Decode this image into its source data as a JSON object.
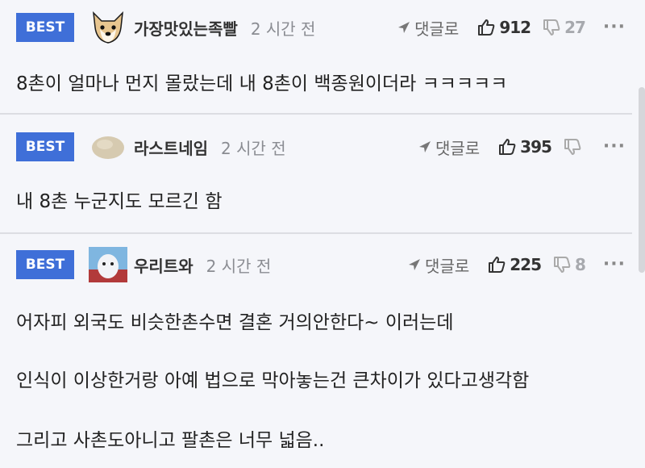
{
  "comments": [
    {
      "badge": "BEST",
      "nickname": "가장맛있는족빨",
      "time": "2 시간 전",
      "reply_label": "댓글로",
      "likes": "912",
      "dislikes": "27",
      "lines": [
        "8촌이 얼마나 먼지 몰랐는데 내 8촌이 백종원이더라 ㅋㅋㅋㅋㅋ"
      ]
    },
    {
      "badge": "BEST",
      "nickname": "라스트네임",
      "time": "2 시간 전",
      "reply_label": "댓글로",
      "likes": "395",
      "dislikes": "",
      "lines": [
        "내 8촌 누군지도 모르긴 함"
      ]
    },
    {
      "badge": "BEST",
      "nickname": "우리트와",
      "time": "2 시간 전",
      "reply_label": "댓글로",
      "likes": "225",
      "dislikes": "8",
      "lines": [
        "어자피 외국도 비슷한촌수면 결혼 거의안한다~ 이러는데",
        "인식이 이상한거랑 아예 법으로 막아놓는건 큰차이가 있다고생각함",
        "그리고 사촌도아니고 팔촌은 너무 넓음.."
      ]
    }
  ],
  "colors": {
    "badge": "#3f6fd8",
    "background": "#f5f6fa",
    "divider": "#dcdde2"
  }
}
